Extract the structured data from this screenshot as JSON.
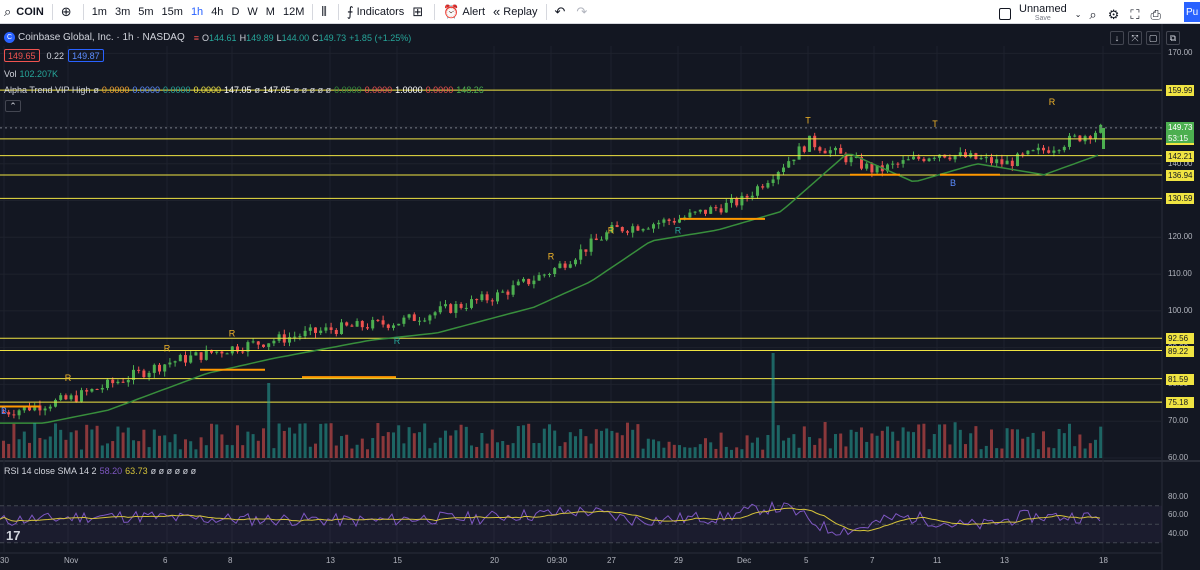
{
  "toolbar": {
    "symbol": "COIN",
    "intervals": [
      "1m",
      "3m",
      "5m",
      "15m",
      "1h",
      "4h",
      "D",
      "W",
      "M",
      "12M"
    ],
    "active_interval": "1h",
    "indicators_label": "Indicators",
    "alert_label": "Alert",
    "replay_label": "Replay",
    "layout_name": "Unnamed",
    "layout_sub": "Save",
    "publish_label": "Pu"
  },
  "legend": {
    "title": "Coinbase Global, Inc. · 1h · NASDAQ",
    "ohlc": {
      "o_label": "O",
      "o": "144.61",
      "h_label": "H",
      "h": "149.89",
      "l_label": "L",
      "l": "144.00",
      "c_label": "C",
      "c": "149.73",
      "chg": "+1.85 (+1.25%)"
    },
    "bid": "149.65",
    "spread": "0.22",
    "ask": "149.87",
    "vol_label": "Vol",
    "vol_value": "102.207K",
    "alpha_label": "Alpha Trend VIP High",
    "alpha_values": [
      "ø",
      "0.0000",
      "0.0000",
      "0.0000",
      "0.0000",
      "147.05",
      "ø",
      "147.05",
      "ø ø ø ø ø",
      "0.0000",
      "0.0000",
      "1.0000",
      "0.0000",
      "148.26"
    ],
    "rsi_label": "RSI 14 close SMA 14 2",
    "rsi_value": "58.20",
    "rsi_sma": "63.73",
    "rsi_rest": "ø ø ø ø ø ø"
  },
  "colors": {
    "background": "#131722",
    "grid": "#1e222d",
    "up": "#4caf50",
    "down": "#ef5350",
    "level_line": "#f0e442",
    "trend": "#388e3c",
    "rsi_line": "#7e57c2",
    "rsi_sma": "#d4c23a",
    "last_price_bg": "#4caf50"
  },
  "price_axis": {
    "labels": [
      "170.00",
      "160.00",
      "150.00",
      "140.00",
      "130.00",
      "120.00",
      "110.00",
      "100.00",
      "90.00",
      "80.00",
      "70.00",
      "60.00"
    ],
    "level_tags": [
      "159.99",
      "146.74",
      "142.21",
      "136.94",
      "130.59",
      "92.56",
      "89.22",
      "81.59",
      "75.18"
    ],
    "last_price": "149.73",
    "countdown": "53:15"
  },
  "rsi_axis": {
    "labels": [
      "80.00",
      "60.00",
      "40.00"
    ]
  },
  "time_axis": {
    "labels": [
      "30",
      "Nov",
      "6",
      "8",
      "13",
      "15",
      "20",
      "09:30",
      "27",
      "29",
      "Dec",
      "5",
      "7",
      "11",
      "13",
      "18"
    ]
  },
  "chart_data": {
    "type": "candlestick",
    "symbol": "COIN",
    "interval": "1h",
    "ylim": [
      60,
      172
    ],
    "horizontal_levels": [
      159.99,
      146.74,
      142.21,
      136.94,
      130.59,
      92.56,
      89.22,
      81.59,
      75.18
    ],
    "last_close": 149.73,
    "close_trajectory": [
      {
        "x": "30",
        "y": 72.5
      },
      {
        "x": "Nov",
        "y": 76
      },
      {
        "x": "6",
        "y": 86
      },
      {
        "x": "8",
        "y": 90
      },
      {
        "x": "13",
        "y": 95
      },
      {
        "x": "15",
        "y": 97
      },
      {
        "x": "20",
        "y": 104
      },
      {
        "x": "09:30",
        "y": 111
      },
      {
        "x": "27",
        "y": 122
      },
      {
        "x": "29",
        "y": 125
      },
      {
        "x": "Dec",
        "y": 130
      },
      {
        "x": "5",
        "y": 146
      },
      {
        "x": "7",
        "y": 138
      },
      {
        "x": "11",
        "y": 143
      },
      {
        "x": "13",
        "y": 140
      },
      {
        "x": "18",
        "y": 149.73
      }
    ],
    "signal_markers": [
      {
        "label": "B",
        "x": "30",
        "near": 72
      },
      {
        "label": "R",
        "x": "Nov",
        "near": 81
      },
      {
        "label": "R",
        "x": "6",
        "near": 89
      },
      {
        "label": "R",
        "x": "8",
        "near": 93
      },
      {
        "label": "R",
        "x": "15",
        "near": 91
      },
      {
        "label": "R",
        "x": "09:30",
        "near": 114
      },
      {
        "label": "R",
        "x": "27",
        "near": 121
      },
      {
        "label": "R",
        "x": "29",
        "near": 121
      },
      {
        "label": "T",
        "x": "5",
        "near": 151
      },
      {
        "label": "T",
        "x": "11",
        "near": 150
      },
      {
        "label": "B",
        "x": "11",
        "near": 134
      },
      {
        "label": "R",
        "x": "18",
        "near": 156
      }
    ],
    "rsi": {
      "ylim": [
        20,
        100
      ],
      "levels": [
        70,
        50,
        30
      ],
      "last": 58.2,
      "sma_last": 63.73
    }
  }
}
